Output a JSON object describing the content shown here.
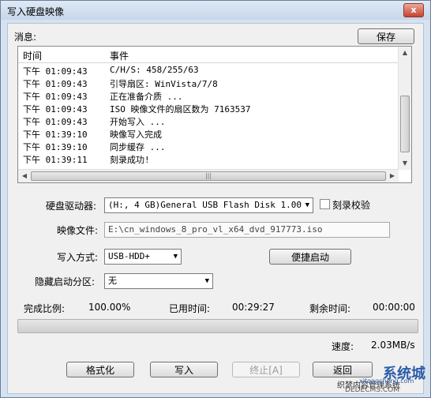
{
  "window": {
    "title": "写入硬盘映像",
    "close_glyph": "x"
  },
  "messages": {
    "label": "消息:",
    "save_label": "保存",
    "col_time": "时间",
    "col_event": "事件",
    "rows": [
      {
        "time": "下午 01:09:43",
        "event": "C/H/S: 458/255/63"
      },
      {
        "time": "下午 01:09:43",
        "event": "引导扇区: WinVista/7/8"
      },
      {
        "time": "下午 01:09:43",
        "event": "正在准备介质 ..."
      },
      {
        "time": "下午 01:09:43",
        "event": "ISO 映像文件的扇区数为 7163537"
      },
      {
        "time": "下午 01:09:43",
        "event": "开始写入 ..."
      },
      {
        "time": "下午 01:39:10",
        "event": "映像写入完成"
      },
      {
        "time": "下午 01:39:10",
        "event": "同步缓存 ..."
      },
      {
        "time": "下午 01:39:11",
        "event": "刻录成功!"
      }
    ]
  },
  "form": {
    "drive_label": "硬盘驱动器:",
    "drive_value": "(H:, 4 GB)General USB Flash Disk  1.00",
    "verify_label": "刻录校验",
    "verify_checked": false,
    "image_label": "映像文件:",
    "image_value": "E:\\cn_windows_8_pro_vl_x64_dvd_917773.iso",
    "write_mode_label": "写入方式:",
    "write_mode_value": "USB-HDD+",
    "quick_boot_label": "便捷启动",
    "hidden_partition_label": "隐藏启动分区:",
    "hidden_partition_value": "无"
  },
  "status": {
    "complete_label": "完成比例:",
    "complete_value": "100.00%",
    "elapsed_label": "已用时间:",
    "elapsed_value": "00:29:27",
    "remaining_label": "剩余时间:",
    "remaining_value": "00:00:00",
    "progress_fraction": 1.0,
    "speed_label": "速度:",
    "speed_value": "2.03MB/s"
  },
  "buttons": {
    "format_label": "格式化",
    "write_label": "写入",
    "stop_label": "终止[A]",
    "back_label": "返回"
  },
  "watermark": {
    "line1": "系统城",
    "line2": "织梦内容管理系统",
    "line3": "DEDECMS.COM",
    "line4": "xitongcheng.com"
  }
}
